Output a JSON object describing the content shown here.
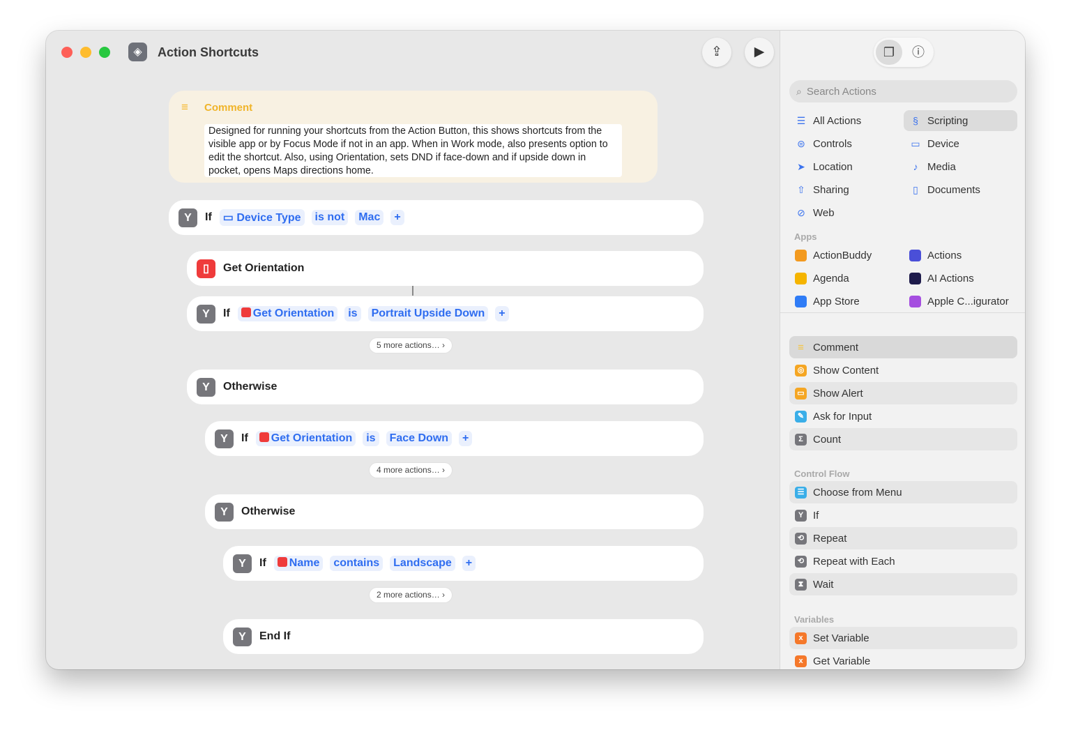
{
  "window": {
    "title": "Action Shortcuts"
  },
  "comment": {
    "label": "Comment",
    "text": "Designed for running your shortcuts from the Action Button, this shows shortcuts from the visible app or by Focus Mode if not in an app. When in Work mode, also presents option to edit the shortcut. Also, using Orientation, sets DND if face-down and if upside down in pocket, opens Maps directions home."
  },
  "flow": {
    "if1": {
      "kw": "If",
      "var": "Device Type",
      "op": "is not",
      "val": "Mac"
    },
    "get": {
      "label": "Get Orientation"
    },
    "if2": {
      "kw": "If",
      "var": "Get Orientation",
      "op": "is",
      "val": "Portrait Upside Down"
    },
    "more1": "5 more actions…",
    "other1": "Otherwise",
    "if3": {
      "kw": "If",
      "var": "Get Orientation",
      "op": "is",
      "val": "Face Down"
    },
    "more2": "4 more actions…",
    "other2": "Otherwise",
    "if4": {
      "kw": "If",
      "var": "Name",
      "op": "contains",
      "val": "Landscape"
    },
    "more3": "2 more actions…",
    "endif": "End If",
    "plus": "+"
  },
  "sidebar": {
    "search_placeholder": "Search Actions",
    "categories": [
      {
        "label": "All Actions",
        "icon": "list-icon",
        "glyph": "☰"
      },
      {
        "label": "Scripting",
        "icon": "scripting-icon",
        "glyph": "§",
        "selected": true
      },
      {
        "label": "Controls",
        "icon": "controls-icon",
        "glyph": "⊜"
      },
      {
        "label": "Device",
        "icon": "device-icon",
        "glyph": "▭"
      },
      {
        "label": "Location",
        "icon": "location-icon",
        "glyph": "➤"
      },
      {
        "label": "Media",
        "icon": "music-note-icon",
        "glyph": "♪"
      },
      {
        "label": "Sharing",
        "icon": "share-icon",
        "glyph": "⇧"
      },
      {
        "label": "Documents",
        "icon": "document-icon",
        "glyph": "▯"
      },
      {
        "label": "Web",
        "icon": "compass-icon",
        "glyph": "⊘"
      }
    ],
    "apps_header": "Apps",
    "apps": [
      {
        "label": "ActionBuddy",
        "color": "#f39a1f"
      },
      {
        "label": "Actions",
        "color": "#4a4fd8"
      },
      {
        "label": "Agenda",
        "color": "#f5b400"
      },
      {
        "label": "AI Actions",
        "color": "#1e1b4b"
      },
      {
        "label": "App Store",
        "color": "#2f7cf6"
      },
      {
        "label": "Apple C...igurator",
        "color": "#a54ee0"
      }
    ],
    "actions": [
      {
        "label": "Comment",
        "color": "#f5c542",
        "glyph": "≡",
        "style": "sel"
      },
      {
        "label": "Show Content",
        "color": "#f5a623",
        "glyph": "◎"
      },
      {
        "label": "Show Alert",
        "color": "#f5a623",
        "glyph": "▭",
        "style": "alt"
      },
      {
        "label": "Ask for Input",
        "color": "#3aaee8",
        "glyph": "✎"
      },
      {
        "label": "Count",
        "color": "#76767b",
        "glyph": "Σ",
        "style": "alt"
      }
    ],
    "control_header": "Control Flow",
    "control": [
      {
        "label": "Choose from Menu",
        "color": "#3aaee8",
        "glyph": "☰",
        "style": "alt"
      },
      {
        "label": "If",
        "color": "#76767b",
        "glyph": "Y"
      },
      {
        "label": "Repeat",
        "color": "#76767b",
        "glyph": "⟲",
        "style": "alt"
      },
      {
        "label": "Repeat with Each",
        "color": "#76767b",
        "glyph": "⟲"
      },
      {
        "label": "Wait",
        "color": "#76767b",
        "glyph": "⧗",
        "style": "alt"
      }
    ],
    "variables_header": "Variables",
    "variables": [
      {
        "label": "Set Variable",
        "color": "#f5782a",
        "glyph": "x",
        "style": "alt"
      },
      {
        "label": "Get Variable",
        "color": "#f5782a",
        "glyph": "x"
      }
    ]
  }
}
